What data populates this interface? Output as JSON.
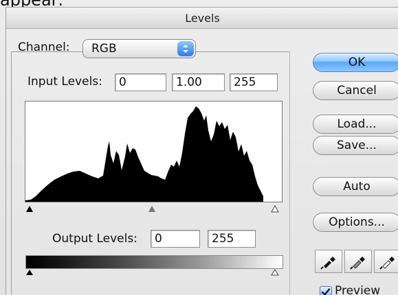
{
  "page": {
    "clip_text": "appear:",
    "window_title": "Levels"
  },
  "channel": {
    "label": "Channel:",
    "value": "RGB"
  },
  "input_levels": {
    "label": "Input Levels:",
    "black": "0",
    "gamma": "1.00",
    "white": "255"
  },
  "output_levels": {
    "label": "Output Levels:",
    "black": "0",
    "white": "255"
  },
  "buttons": {
    "ok": "OK",
    "cancel": "Cancel",
    "load": "Load...",
    "save": "Save...",
    "auto": "Auto",
    "options": "Options..."
  },
  "preview": {
    "label": "Preview",
    "checked": true
  },
  "icons": {
    "select_arrows": "up-down-arrows-icon",
    "black_eyedropper": "eyedropper-black-icon",
    "gray_eyedropper": "eyedropper-gray-icon",
    "white_eyedropper": "eyedropper-white-icon",
    "check": "checkmark-icon"
  },
  "colors": {
    "primary_button": "#5aa8f5",
    "checkbox": "#5e9ced"
  }
}
